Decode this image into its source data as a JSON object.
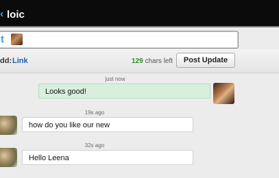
{
  "header": {
    "back_glyph": "‹",
    "title": "loic"
  },
  "composer": {
    "service_icon": "twitter-bird-icon",
    "service_glyph": "t"
  },
  "actions": {
    "add_label": "dd:",
    "link_label": "Link",
    "chars_count": "129",
    "chars_suffix": "chars left",
    "post_label": "Post Update"
  },
  "messages": [
    {
      "time": "just now",
      "text": "Looks good!",
      "direction": "outgoing"
    },
    {
      "time": "19s ago",
      "text": "how do you like our new",
      "direction": "incoming"
    },
    {
      "time": "32s ago",
      "text": "Hello Leena",
      "direction": "incoming"
    }
  ],
  "colors": {
    "topbar": "#0b0b0b",
    "outgoing_bubble": "#d8efde",
    "link": "#1f5fa8",
    "chars_count": "#2f8a2f",
    "twitter": "#3ea0d6"
  }
}
